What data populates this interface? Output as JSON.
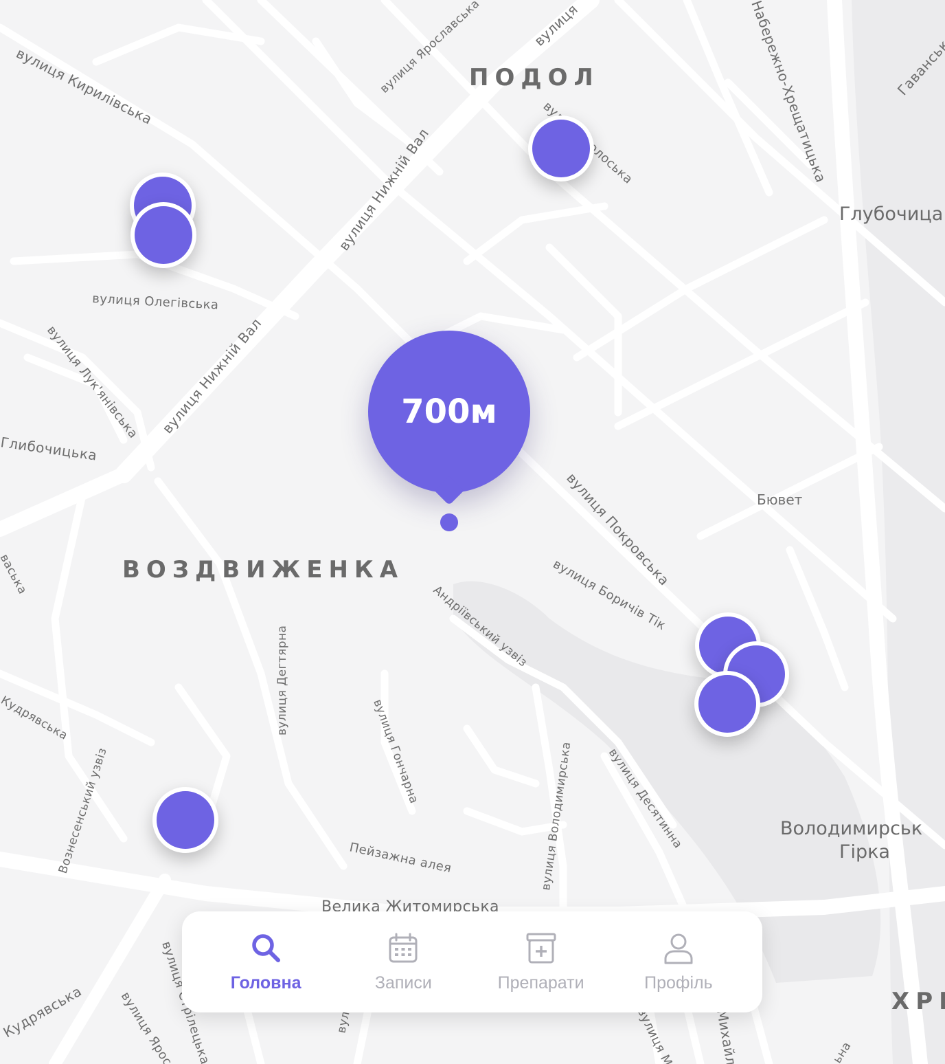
{
  "map": {
    "districts": [
      "ПОДОЛ",
      "ВОЗДВИЖЕНКА",
      "ХРЕ"
    ],
    "places": [
      "Глубочица",
      "Володимирськ",
      "Гірка"
    ],
    "pois": [
      "Бювет"
    ],
    "streets": {
      "kyrylivska": "вулиця Кирилівська",
      "yaroslavska": "вулиця Ярославська",
      "vulytsia_top": "вулиця",
      "naberezhno": "Набережно-Хрещатицька",
      "havanska": "Гаванська",
      "nyzhnii_val_1": "вулиця Нижній Вал",
      "nyzhnii_val_2": "вулиця Нижній Вал",
      "volosska": "вулиця Волоська",
      "olehivska": "вулиця Олегівська",
      "lukianivska": "вулиця Лук'янівська",
      "hlybochytska": "Глибочицька",
      "pokrovska": "вулиця Покровська",
      "borychiv_tik": "вулиця Боричів Тік",
      "andriivskyi": "Андріївський узвіз",
      "dehtiarna": "вулиця Дегтярна",
      "honcharna": "вулиця Гончарна",
      "volodymyrska": "вулиця Володимирська",
      "desiatynna": "вулиця Десятинна",
      "kudriavska_1": "Кудрявська",
      "kudriavska_2": "Кудрявська",
      "voznesenskyi": "Вознесенський узвіз",
      "peizazhna": "Пейзажна алея",
      "velyka_zhytomyrska": "Велика Житомирська",
      "yaroslaviv_val": "вулиця Ярославів",
      "striletska": "вулиця Стрілецька",
      "mala_zhytomyrska": "вулиця Мала",
      "mykhailivska": "Михайлівська",
      "left_edge": "васька",
      "bottom_cut": "вулиця",
      "bottom_right": "ьна"
    }
  },
  "radius": {
    "label": "700м"
  },
  "tabs": [
    {
      "label": "Головна",
      "icon": "search-icon",
      "active": true
    },
    {
      "label": "Записи",
      "icon": "calendar-icon",
      "active": false
    },
    {
      "label": "Препарати",
      "icon": "pharmacy-box-icon",
      "active": false
    },
    {
      "label": "Профіль",
      "icon": "user-icon",
      "active": false
    }
  ],
  "colors": {
    "accent": "#6e63e3",
    "inactive": "#b0b0b8",
    "map_bg": "#f5f5f6",
    "road": "#ffffff"
  }
}
